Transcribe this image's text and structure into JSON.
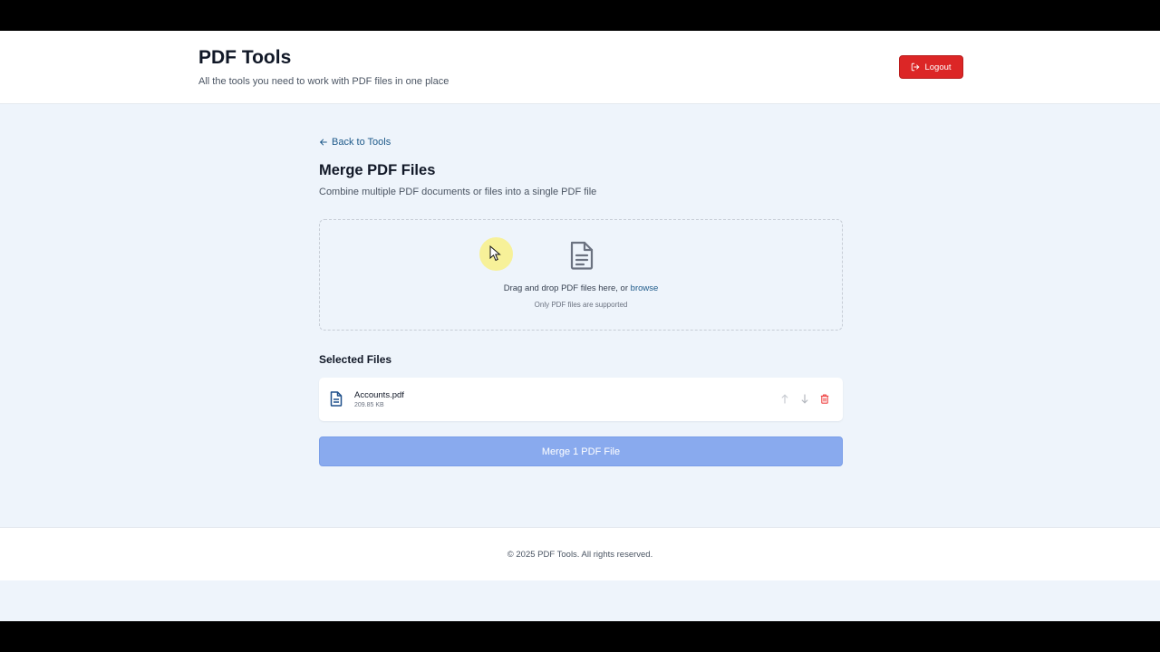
{
  "header": {
    "title": "PDF Tools",
    "subtitle": "All the tools you need to work with PDF files in one place",
    "logout_label": "Logout",
    "logout_color": "#dc2626"
  },
  "nav": {
    "back_label": "Back to Tools"
  },
  "page": {
    "title": "Merge PDF Files",
    "subtitle": "Combine multiple PDF documents or files into a single PDF file"
  },
  "dropzone": {
    "text": "Drag and drop PDF files here, or ",
    "browse_label": "browse",
    "note": "Only PDF files are supported",
    "icon": "document-icon"
  },
  "selected": {
    "title": "Selected Files",
    "files": [
      {
        "name": "Accounts.pdf",
        "size": "209.85 KB"
      }
    ]
  },
  "merge_button": {
    "label": "Merge 1 PDF File",
    "color": "#89aaee"
  },
  "footer": {
    "copyright": "© 2025 PDF Tools. All rights reserved."
  }
}
